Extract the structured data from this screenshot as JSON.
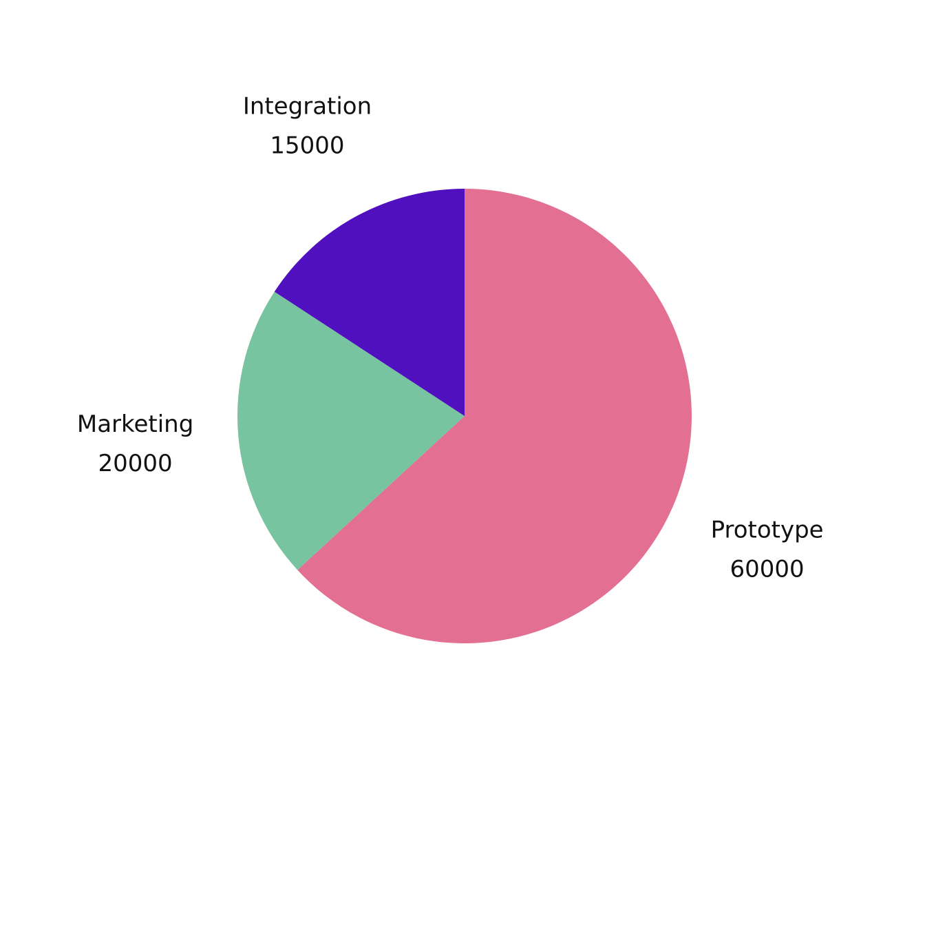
{
  "chart_data": {
    "type": "pie",
    "title": "",
    "slices": [
      {
        "label": "Prototype",
        "value": 60000,
        "display": "60000",
        "color": "#e37092"
      },
      {
        "label": "Marketing",
        "value": 20000,
        "display": "20000",
        "color": "#78c3a0"
      },
      {
        "label": "Integration",
        "value": 15000,
        "display": "15000",
        "color": "#5110bf"
      }
    ],
    "start_angle_deg": 0,
    "direction": "clockwise",
    "legend": "none",
    "labels": "outside"
  }
}
